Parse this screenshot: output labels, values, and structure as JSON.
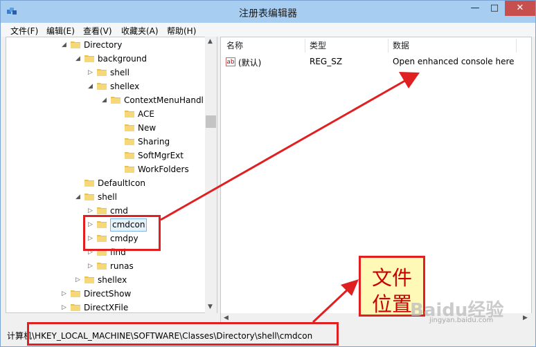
{
  "window": {
    "title": "注册表编辑器",
    "minimize": "—",
    "maximize": "□",
    "close": "✕"
  },
  "menu": [
    "文件(F)",
    "编辑(E)",
    "查看(V)",
    "收藏夹(A)",
    "帮助(H)"
  ],
  "tree": [
    {
      "label": "Directory",
      "expander": "◢"
    },
    {
      "label": "background",
      "expander": "◢"
    },
    {
      "label": "shell",
      "expander": "▷"
    },
    {
      "label": "shellex",
      "expander": "◢"
    },
    {
      "label": "ContextMenuHandl",
      "expander": "◢"
    },
    {
      "label": "ACE",
      "expander": ""
    },
    {
      "label": "New",
      "expander": ""
    },
    {
      "label": "Sharing",
      "expander": ""
    },
    {
      "label": "SoftMgrExt",
      "expander": ""
    },
    {
      "label": "WorkFolders",
      "expander": ""
    },
    {
      "label": "DefaultIcon",
      "expander": ""
    },
    {
      "label": "shell",
      "expander": "◢"
    },
    {
      "label": "cmd",
      "expander": "▷"
    },
    {
      "label": "cmdcon",
      "expander": "▷",
      "selected": true
    },
    {
      "label": "cmdpy",
      "expander": "▷"
    },
    {
      "label": "find",
      "expander": "▷"
    },
    {
      "label": "runas",
      "expander": "▷"
    },
    {
      "label": "shellex",
      "expander": "▷"
    },
    {
      "label": "DirectShow",
      "expander": "▷"
    },
    {
      "label": "DirectXFile",
      "expander": "▷"
    }
  ],
  "list": {
    "headers": {
      "name": "名称",
      "type": "类型",
      "data": "数据"
    },
    "rows": [
      {
        "icon": "ab",
        "name": "(默认)",
        "type": "REG_SZ",
        "data": "Open enhanced console here"
      }
    ]
  },
  "status": {
    "path": "计算机\\HKEY_LOCAL_MACHINE\\SOFTWARE\\Classes\\Directory\\shell\\cmdcon"
  },
  "annotation": {
    "line1": "文件",
    "line2": "位置"
  },
  "watermark": {
    "text": "Baidu经验",
    "sub": "jingyan.baidu.com"
  },
  "colors": {
    "accent": "#e02020",
    "title_bar": "#a7cdf0",
    "close_button": "#c7504f"
  }
}
